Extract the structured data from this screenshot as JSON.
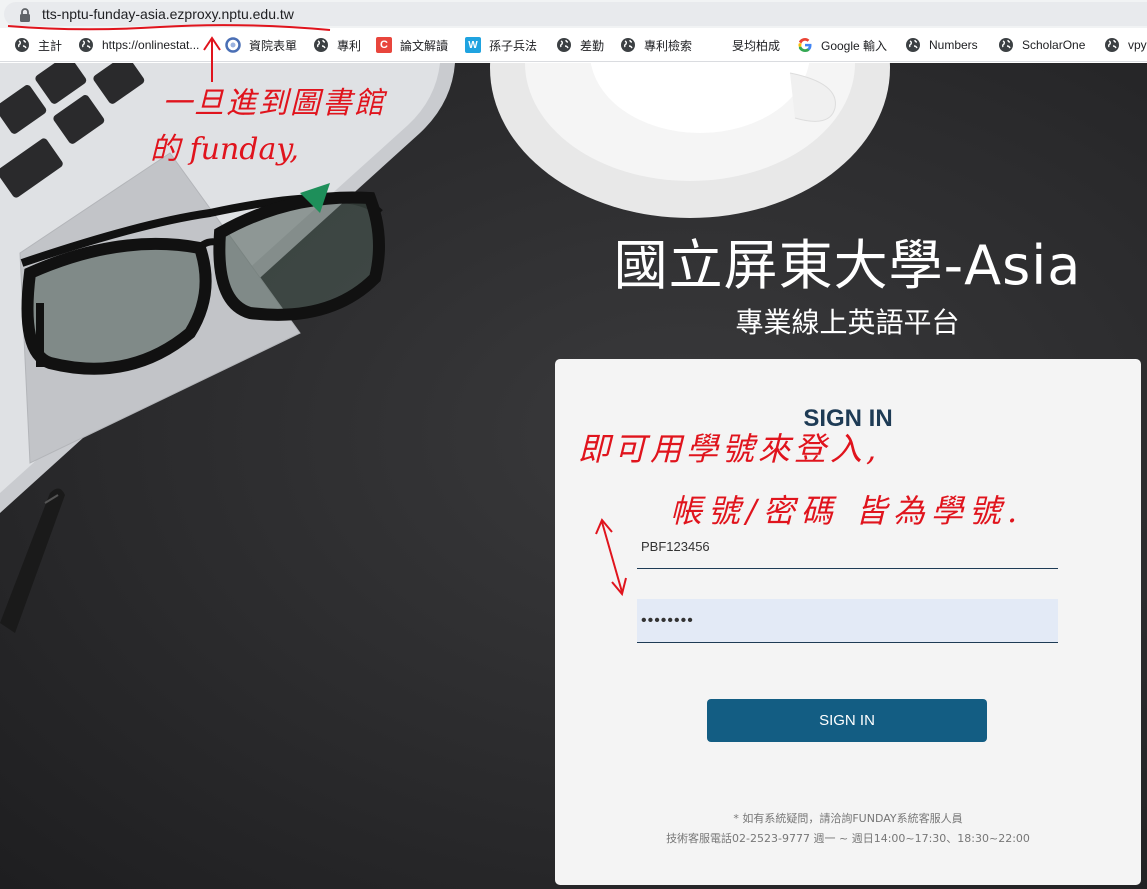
{
  "browser": {
    "url": "tts-nptu-funday-asia.ezproxy.nptu.edu.tw",
    "bookmarks": [
      {
        "label": "主計",
        "icon": "globe-icon"
      },
      {
        "label": "https://onlinestat...",
        "icon": "globe-icon"
      },
      {
        "label": "資院表單",
        "icon": "ring-icon"
      },
      {
        "label": "專利",
        "icon": "globe-icon"
      },
      {
        "label": "論文解讀",
        "icon": "c-square-icon"
      },
      {
        "label": "孫子兵法",
        "icon": "w-square-icon"
      },
      {
        "label": "差勤",
        "icon": "globe-icon"
      },
      {
        "label": "專利檢索",
        "icon": "globe-icon"
      },
      {
        "label": "旻均柏成",
        "icon": "none"
      },
      {
        "label": "Google 輸入",
        "icon": "google-icon"
      },
      {
        "label": "Numbers",
        "icon": "globe-icon"
      },
      {
        "label": "ScholarOne",
        "icon": "globe-icon"
      },
      {
        "label": "vpy",
        "icon": "globe-icon"
      }
    ]
  },
  "hero": {
    "title": "國立屏東大學-Asia",
    "subtitle": "專業線上英語平台"
  },
  "login": {
    "heading": "SIGN IN",
    "account_value": "PBF123456",
    "password_value": "••••••••",
    "button_label": "SIGN IN",
    "note_line1": "* 如有系統疑問，請洽詢FUNDAY系統客服人員",
    "note_line2": "技術客服電話02-2523-9777 週一 ~ 週日14:00~17:30、18:30~22:00"
  },
  "annotations": {
    "line1": "一旦進到圖書館",
    "line2": "的 funday,",
    "line3": "即可用學號來登入,",
    "line4": "帳號/密碼 皆為學號."
  },
  "colors": {
    "accent": "#135d83",
    "heading": "#1e3b55",
    "annotation": "#e0141d"
  }
}
